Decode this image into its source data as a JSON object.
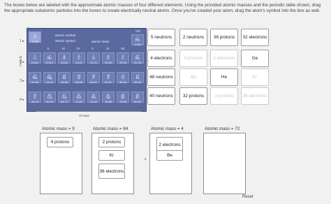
{
  "instructions": "The boxes below are labeled with the approximate atomic masses of four different elements. Using the provided atomic masses and the periodic table shown, drag the appropriate subatomic particles into the boxes to create electrically neutral atoms. Once you've created your atom, drag the atom's symbol into the box as well.",
  "periodic_table": {
    "legend_atomic_number": "atomic number",
    "legend_atomic_symbol": "atomic symbol",
    "legend_atomic_mass": "atomic mass",
    "group_header": [
      "I",
      "II",
      "III",
      "IV",
      "V",
      "VI",
      "VII",
      "VIII"
    ],
    "periods_label": "Periods",
    "groups_label": "Groups",
    "rows": [
      [
        {
          "n": "1",
          "s": "H",
          "m": "1.008"
        },
        {
          "n": "2",
          "s": "He",
          "m": "4.003"
        }
      ],
      [
        {
          "n": "3",
          "s": "Li",
          "m": "6.941"
        },
        {
          "n": "4",
          "s": "Be",
          "m": "9.012"
        },
        {
          "n": "5",
          "s": "B",
          "m": "10.81"
        },
        {
          "n": "6",
          "s": "C",
          "m": "12.01"
        },
        {
          "n": "7",
          "s": "N",
          "m": "14.01"
        },
        {
          "n": "8",
          "s": "O",
          "m": "16.00"
        },
        {
          "n": "9",
          "s": "F",
          "m": "19.00"
        },
        {
          "n": "10",
          "s": "Ne",
          "m": "20.18"
        }
      ],
      [
        {
          "n": "11",
          "s": "Na",
          "m": "22.99"
        },
        {
          "n": "12",
          "s": "Mg",
          "m": "24.31"
        },
        {
          "n": "13",
          "s": "Al",
          "m": "26.98"
        },
        {
          "n": "14",
          "s": "Si",
          "m": "28.09"
        },
        {
          "n": "15",
          "s": "P",
          "m": "30.97"
        },
        {
          "n": "16",
          "s": "S",
          "m": "32.07"
        },
        {
          "n": "17",
          "s": "Cl",
          "m": "35.45"
        },
        {
          "n": "18",
          "s": "Ar",
          "m": "39.95"
        }
      ],
      [
        {
          "n": "19",
          "s": "K",
          "m": "39.10"
        },
        {
          "n": "20",
          "s": "Ca",
          "m": "40.08"
        },
        {
          "n": "31",
          "s": "Ga",
          "m": "69.72"
        },
        {
          "n": "32",
          "s": "Ge",
          "m": "72.59"
        },
        {
          "n": "33",
          "s": "As",
          "m": "74.92"
        },
        {
          "n": "34",
          "s": "Se",
          "m": "78.96"
        },
        {
          "n": "35",
          "s": "Br",
          "m": "79.90"
        },
        {
          "n": "36",
          "s": "Kr",
          "m": "83.80"
        }
      ]
    ]
  },
  "tiles": [
    {
      "label": "5 neutrons",
      "faded": false
    },
    {
      "label": "2 neutrons",
      "faded": false
    },
    {
      "label": "36 protons",
      "faded": false
    },
    {
      "label": "32 electrons",
      "faded": false
    },
    {
      "label": "4 electrons",
      "faded": false
    },
    {
      "label": "4 protons",
      "faded": true
    },
    {
      "label": "2 electrons",
      "faded": true
    },
    {
      "label": "Ge",
      "faded": false
    },
    {
      "label": "48 neutrons",
      "faded": false
    },
    {
      "label": "Be",
      "faded": true
    },
    {
      "label": "He",
      "faded": false
    },
    {
      "label": "Kr",
      "faded": true
    },
    {
      "label": "40 neutrons",
      "faded": false
    },
    {
      "label": "32 protons",
      "faded": false
    },
    {
      "label": "2 protons",
      "faded": true
    },
    {
      "label": "36 electrons",
      "faded": true
    }
  ],
  "zones": [
    {
      "label": "Atomic mass = 9",
      "items": [
        "4 protons"
      ]
    },
    {
      "label": "Atomic mass = 84",
      "items": [
        "2 protons",
        "Kr",
        "36 electrons"
      ]
    },
    {
      "label": "Atomic mass = 4",
      "items": [
        "2 electrons",
        "Be"
      ]
    },
    {
      "label": "Atomic mass = 72",
      "items": []
    }
  ],
  "reset_label": "Reset"
}
